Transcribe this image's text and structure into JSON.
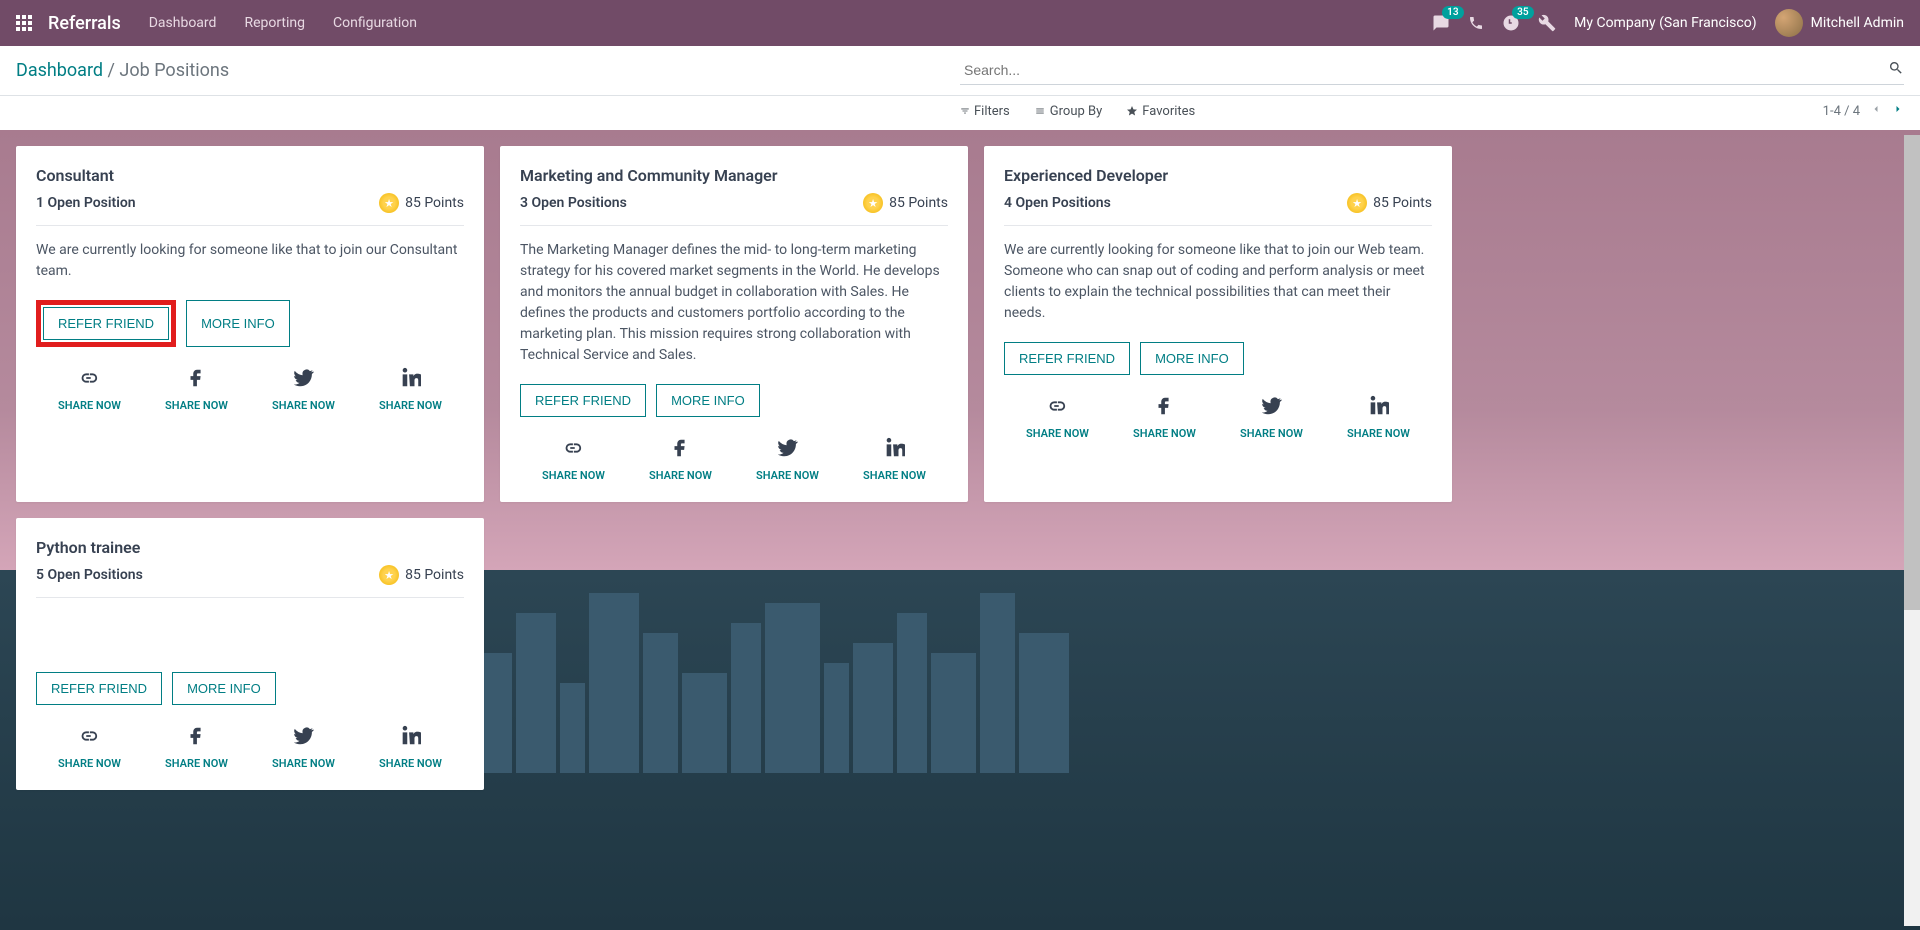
{
  "topbar": {
    "app_title": "Referrals",
    "nav": [
      "Dashboard",
      "Reporting",
      "Configuration"
    ],
    "msg_count": "13",
    "activity_count": "35",
    "company": "My Company (San Francisco)",
    "user": "Mitchell Admin"
  },
  "breadcrumb": {
    "root": "Dashboard",
    "sep": " / ",
    "current": "Job Positions"
  },
  "search": {
    "placeholder": "Search..."
  },
  "filters": {
    "filters_label": "Filters",
    "groupby_label": "Group By",
    "favorites_label": "Favorites"
  },
  "pager": {
    "range": "1-4 / 4"
  },
  "labels": {
    "refer": "REFER FRIEND",
    "moreinfo": "MORE INFO",
    "sharenow": "SHARE NOW",
    "points_suffix": "Points"
  },
  "cards": [
    {
      "title": "Consultant",
      "open": "1 Open Position",
      "points": "85",
      "desc": "We are currently looking for someone like that to join our Consultant team.",
      "highlight_refer": true
    },
    {
      "title": "Marketing and Community Manager",
      "open": "3 Open Positions",
      "points": "85",
      "desc": "The Marketing Manager defines the mid- to long-term marketing strategy for his covered market segments in the World. He develops and monitors the annual budget in collaboration with Sales. He defines the products and customers portfolio according to the marketing plan. This mission requires strong collaboration with Technical Service and Sales.",
      "highlight_refer": false
    },
    {
      "title": "Experienced Developer",
      "open": "4 Open Positions",
      "points": "85",
      "desc": "We are currently looking for someone like that to join our Web team. Someone who can snap out of coding and perform analysis or meet clients to explain the technical possibilities that can meet their needs.",
      "highlight_refer": false
    },
    {
      "title": "Python trainee",
      "open": "5 Open Positions",
      "points": "85",
      "desc": "",
      "highlight_refer": false
    }
  ]
}
